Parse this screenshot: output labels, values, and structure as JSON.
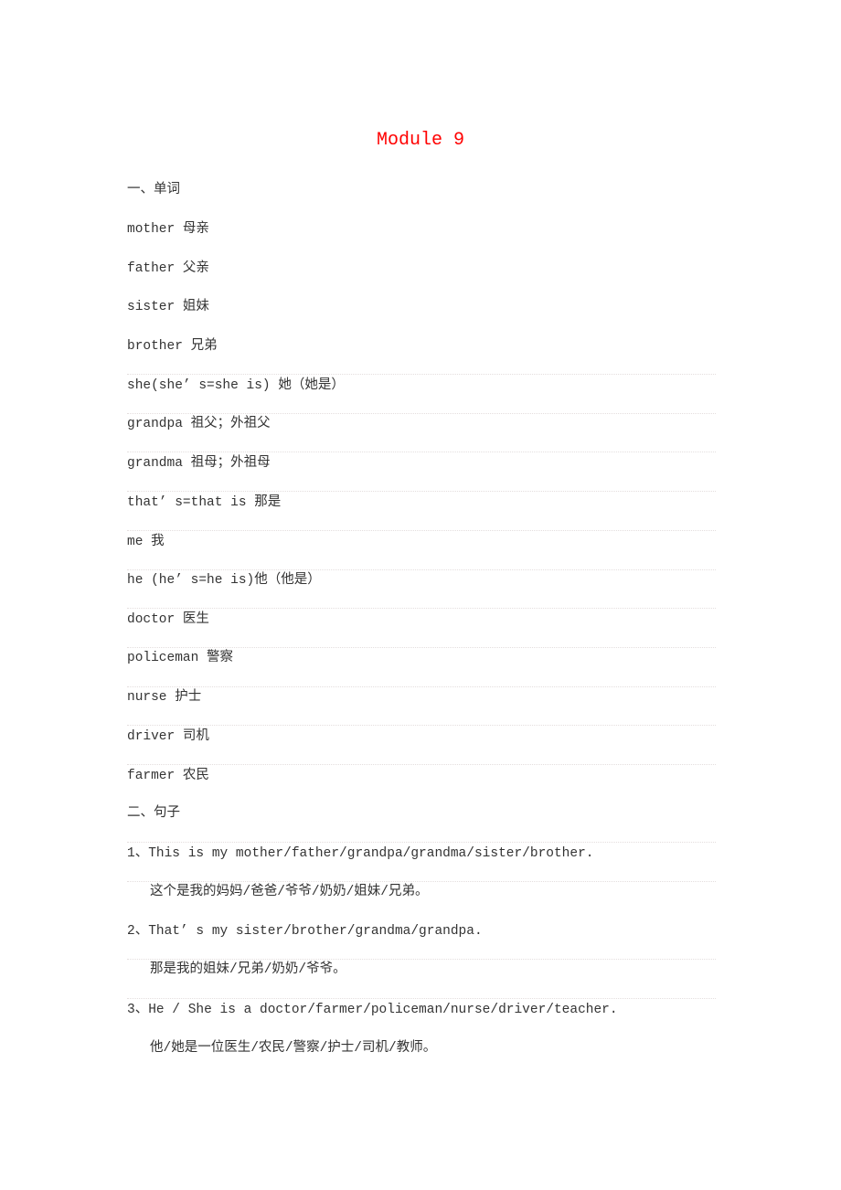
{
  "document": {
    "title": "Module 9",
    "sections": {
      "vocab_heading": "一、单词",
      "sentences_heading": "二、句子"
    },
    "vocabulary": [
      "mother 母亲",
      "father 父亲",
      "sister 姐妹",
      "brother 兄弟",
      "she(she’ s=she is) 她（她是）",
      "grandpa 祖父；外祖父",
      "grandma 祖母；外祖母",
      "that’ s=that is 那是",
      "me 我",
      "he (he’ s=he is)他（他是）",
      "doctor 医生",
      "policeman 警察",
      "nurse 护士",
      "driver 司机",
      "farmer 农民"
    ],
    "sentences": [
      {
        "en": "1、This is my mother/father/grandpa/grandma/sister/brother.",
        "zh": "这个是我的妈妈/爸爸/爷爷/奶奶/姐妹/兄弟。"
      },
      {
        "en": "2、That’ s my sister/brother/grandma/grandpa.",
        "zh": "那是我的姐妹/兄弟/奶奶/爷爷。"
      },
      {
        "en": "3、He / She is a doctor/farmer/policeman/nurse/driver/teacher.",
        "zh": "他/她是一位医生/农民/警察/护士/司机/教师。"
      }
    ]
  }
}
